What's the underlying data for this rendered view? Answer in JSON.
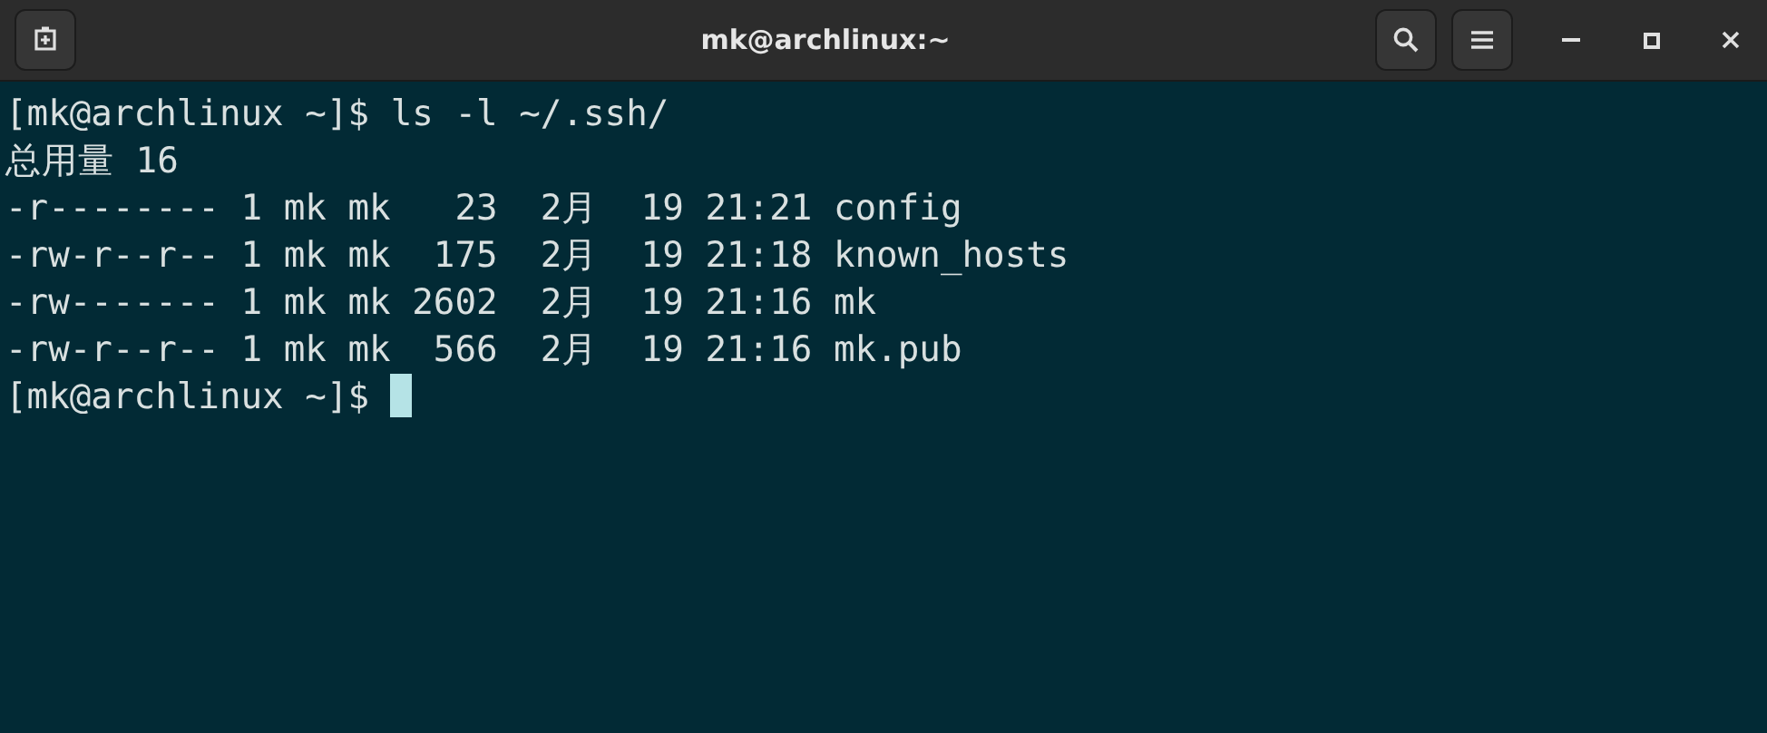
{
  "window": {
    "title": "mk@archlinux:~"
  },
  "terminal": {
    "lines": [
      {
        "text": "[mk@archlinux ~]$ ls -l ~/.ssh/",
        "cursor": false
      },
      {
        "text": "总用量 16",
        "cursor": false
      },
      {
        "text": "-r-------- 1 mk mk   23  2月  19 21:21 config",
        "cursor": false
      },
      {
        "text": "-rw-r--r-- 1 mk mk  175  2月  19 21:18 known_hosts",
        "cursor": false
      },
      {
        "text": "-rw------- 1 mk mk 2602  2月  19 21:16 mk",
        "cursor": false
      },
      {
        "text": "-rw-r--r-- 1 mk mk  566  2月  19 21:16 mk.pub",
        "cursor": false
      },
      {
        "text": "[mk@archlinux ~]$ ",
        "cursor": true
      }
    ]
  }
}
